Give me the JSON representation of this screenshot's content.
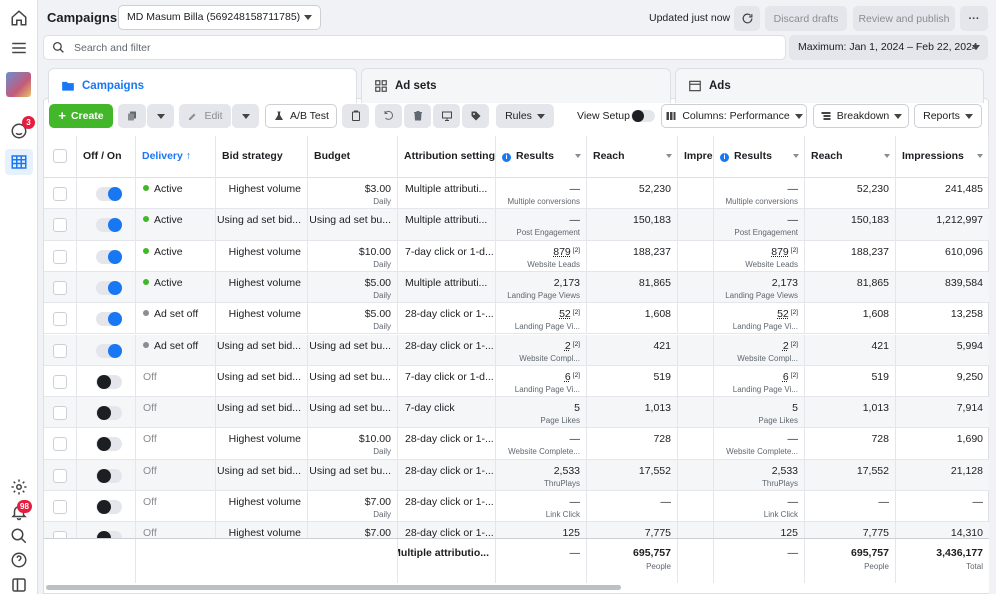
{
  "header": {
    "title": "Campaigns",
    "account": "MD Masum Billa (569248158711785)",
    "updated": "Updated just now",
    "discard_label": "Discard drafts",
    "review_label": "Review and publish",
    "more_label": "···"
  },
  "rail": {
    "ads_badge": "3",
    "notifications_badge": "98"
  },
  "search": {
    "placeholder": "Search and filter"
  },
  "date_range": "Maximum:  Jan 1, 2024 – Feb 22, 2024",
  "tabs": [
    {
      "label": "Campaigns"
    },
    {
      "label": "Ad sets"
    },
    {
      "label": "Ads"
    }
  ],
  "toolbar": {
    "create": "Create",
    "edit": "Edit",
    "ab_test": "A/B Test",
    "rules": "Rules",
    "view_setup": "View Setup",
    "columns": "Columns: Performance",
    "breakdown": "Breakdown",
    "reports": "Reports"
  },
  "columns": [
    "Off / On",
    "Delivery ↑",
    "Bid strategy",
    "Budget",
    "Attribution setting",
    "Results",
    "Reach",
    "Impre",
    "Results",
    "Reach",
    "Impressions"
  ],
  "rows": [
    {
      "on": true,
      "delivery": "Active",
      "status": "active",
      "bid": "Highest volume",
      "budget": "$3.00",
      "budget_sub": "Daily",
      "attr": "Multiple attributi...",
      "res": "—",
      "res_sup": "",
      "res_sub": "Multiple conversions",
      "reach": "52,230",
      "res2": "—",
      "res2_sup": "",
      "res2_sub": "Multiple conversions",
      "reach2": "52,230",
      "impr": "241,485"
    },
    {
      "on": true,
      "delivery": "Active",
      "status": "active",
      "bid": "Using ad set bid...",
      "budget": "Using ad set bu...",
      "budget_sub": "",
      "attr": "Multiple attributi...",
      "res": "—",
      "res_sup": "",
      "res_sub": "Post Engagement",
      "reach": "150,183",
      "res2": "—",
      "res2_sup": "",
      "res2_sub": "Post Engagement",
      "reach2": "150,183",
      "impr": "1,212,997"
    },
    {
      "on": true,
      "delivery": "Active",
      "status": "active",
      "bid": "Highest volume",
      "budget": "$10.00",
      "budget_sub": "Daily",
      "attr": "7-day click or 1-d...",
      "res": "879",
      "res_sup": "[2]",
      "res_sub": "Website Leads",
      "reach": "188,237",
      "res2": "879",
      "res2_sup": "[2]",
      "res2_sub": "Website Leads",
      "reach2": "188,237",
      "impr": "610,096"
    },
    {
      "on": true,
      "delivery": "Active",
      "status": "active",
      "bid": "Highest volume",
      "budget": "$5.00",
      "budget_sub": "Daily",
      "attr": "Multiple attributi...",
      "res": "2,173",
      "res_sup": "",
      "res_sub": "Landing Page Views",
      "reach": "81,865",
      "res2": "2,173",
      "res2_sup": "",
      "res2_sub": "Landing Page Views",
      "reach2": "81,865",
      "impr": "839,584"
    },
    {
      "on": true,
      "delivery": "Ad set off",
      "status": "adset",
      "bid": "Highest volume",
      "budget": "$5.00",
      "budget_sub": "Daily",
      "attr": "28-day click or 1-...",
      "res": "52",
      "res_sup": "[2]",
      "res_sub": "Landing Page Vi...",
      "reach": "1,608",
      "res2": "52",
      "res2_sup": "[2]",
      "res2_sub": "Landing Page Vi...",
      "reach2": "1,608",
      "impr": "13,258"
    },
    {
      "on": true,
      "delivery": "Ad set off",
      "status": "adset",
      "bid": "Using ad set bid...",
      "budget": "Using ad set bu...",
      "budget_sub": "",
      "attr": "28-day click or 1-...",
      "res": "2",
      "res_sup": "[2]",
      "res_sub": "Website Compl...",
      "reach": "421",
      "res2": "2",
      "res2_sup": "[2]",
      "res2_sub": "Website Compl...",
      "reach2": "421",
      "impr": "5,994"
    },
    {
      "on": false,
      "delivery": "Off",
      "status": "off",
      "bid": "Using ad set bid...",
      "budget": "Using ad set bu...",
      "budget_sub": "",
      "attr": "7-day click or 1-d...",
      "res": "6",
      "res_sup": "[2]",
      "res_sub": "Landing Page Vi...",
      "reach": "519",
      "res2": "6",
      "res2_sup": "[2]",
      "res2_sub": "Landing Page Vi...",
      "reach2": "519",
      "impr": "9,250"
    },
    {
      "on": false,
      "delivery": "Off",
      "status": "off",
      "bid": "Using ad set bid...",
      "budget": "Using ad set bu...",
      "budget_sub": "",
      "attr": "7-day click",
      "res": "5",
      "res_sup": "",
      "res_sub": "Page Likes",
      "reach": "1,013",
      "res2": "5",
      "res2_sup": "",
      "res2_sub": "Page Likes",
      "reach2": "1,013",
      "impr": "7,914"
    },
    {
      "on": false,
      "delivery": "Off",
      "status": "off",
      "bid": "Highest volume",
      "budget": "$10.00",
      "budget_sub": "Daily",
      "attr": "28-day click or 1-...",
      "res": "—",
      "res_sup": "",
      "res_sub": "Website Complete...",
      "reach": "728",
      "res2": "—",
      "res2_sup": "",
      "res2_sub": "Website Complete...",
      "reach2": "728",
      "impr": "1,690"
    },
    {
      "on": false,
      "delivery": "Off",
      "status": "off",
      "bid": "Using ad set bid...",
      "budget": "Using ad set bu...",
      "budget_sub": "",
      "attr": "28-day click or 1-...",
      "res": "2,533",
      "res_sup": "",
      "res_sub": "ThruPlays",
      "reach": "17,552",
      "res2": "2,533",
      "res2_sup": "",
      "res2_sub": "ThruPlays",
      "reach2": "17,552",
      "impr": "21,128"
    },
    {
      "on": false,
      "delivery": "Off",
      "status": "off",
      "bid": "Highest volume",
      "budget": "$7.00",
      "budget_sub": "Daily",
      "attr": "28-day click or 1-...",
      "res": "—",
      "res_sup": "",
      "res_sub": "Link Click",
      "reach": "—",
      "res2": "—",
      "res2_sup": "",
      "res2_sub": "Link Click",
      "reach2": "—",
      "impr": "—"
    },
    {
      "on": false,
      "delivery": "Off",
      "status": "off",
      "bid": "Highest volume",
      "budget": "$7.00",
      "budget_sub": "Daily",
      "attr": "28-day click or 1-...",
      "res": "125",
      "res_sup": "",
      "res_sub": "",
      "reach": "7,775",
      "res2": "125",
      "res2_sup": "",
      "res2_sub": "",
      "reach2": "7,775",
      "impr": "14,310"
    }
  ],
  "totals": {
    "attr": "Multiple attributio...",
    "res": "—",
    "reach": "695,757",
    "reach_sub": "People",
    "res2": "—",
    "reach2": "695,757",
    "reach2_sub": "People",
    "impr": "3,436,177",
    "impr_sub": "Total"
  },
  "colors": {
    "accent": "#1877f2",
    "create": "#42b72a",
    "active_dot": "#42b72a",
    "off_dot": "#8a8d91",
    "badge": "#e41e3f"
  }
}
